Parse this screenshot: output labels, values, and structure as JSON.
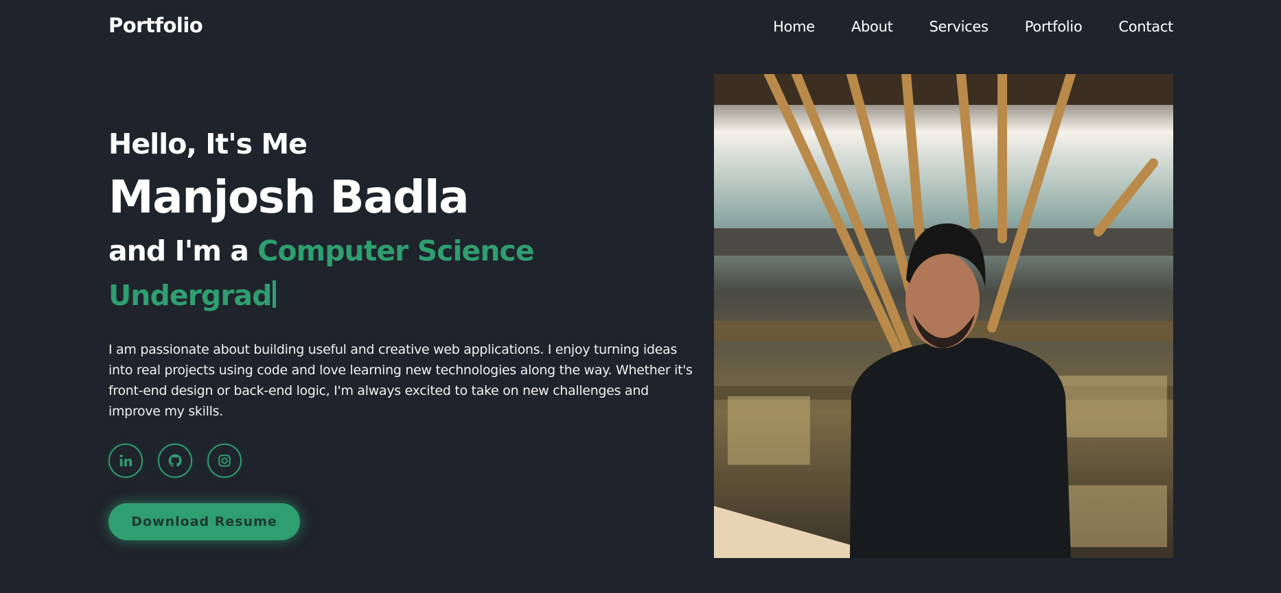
{
  "header": {
    "logo": "Portfolio",
    "nav": [
      "Home",
      "About",
      "Services",
      "Portfolio",
      "Contact"
    ]
  },
  "hero": {
    "greeting": "Hello, It's Me",
    "name": "Manjosh Badla",
    "role_prefix": "and I'm a",
    "role_highlight": "Computer Science Undergrad",
    "bio": "I am passionate about building useful and creative web applications. I enjoy turning ideas into real projects using code and love learning new technologies along the way. Whether it's front-end design or back-end logic, I'm always excited to take on new challenges and improve my skills.",
    "socials": [
      {
        "name": "linkedin",
        "icon": "linkedin-icon"
      },
      {
        "name": "github",
        "icon": "github-icon"
      },
      {
        "name": "instagram",
        "icon": "instagram-icon"
      }
    ],
    "button_label": "Download Resume"
  },
  "colors": {
    "background": "#1f232b",
    "accent": "#2f9e71",
    "text": "#ffffff"
  }
}
